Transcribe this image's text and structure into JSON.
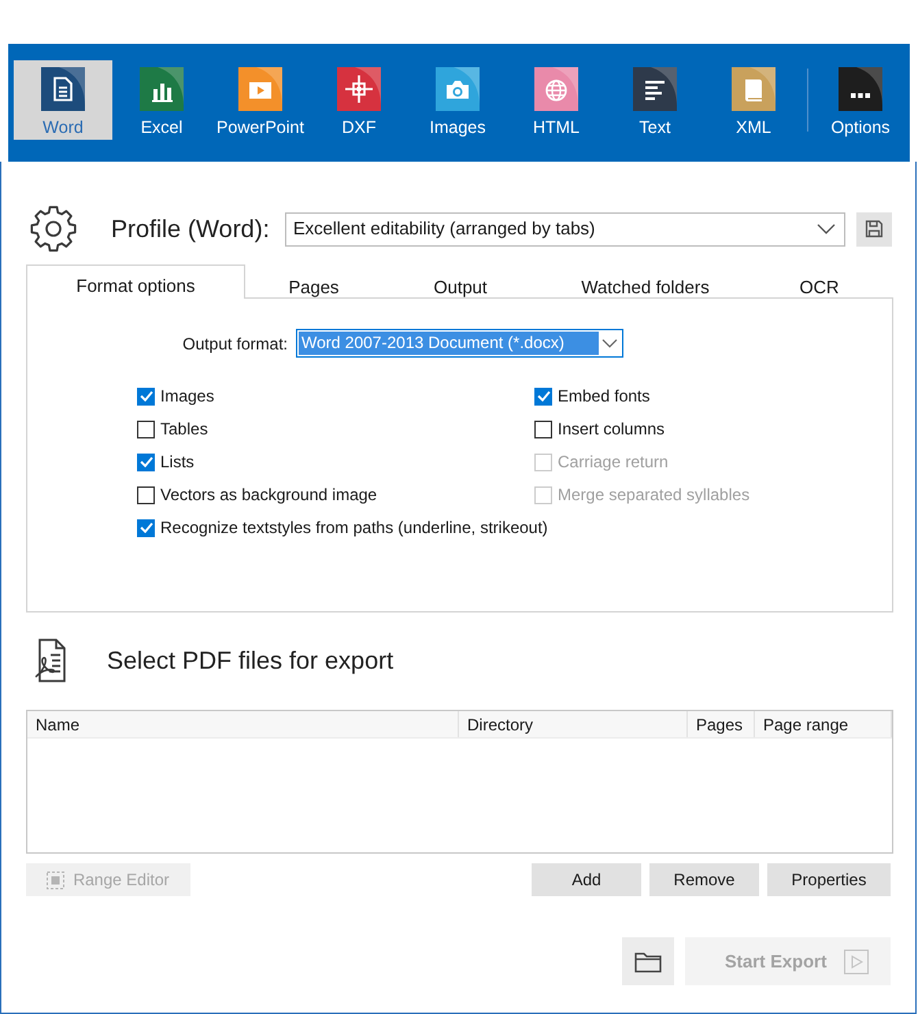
{
  "toolbar": {
    "formats": [
      {
        "kind": "word",
        "label": "Word",
        "selected": true
      },
      {
        "kind": "excel",
        "label": "Excel",
        "selected": false
      },
      {
        "kind": "powerpoint",
        "label": "PowerPoint",
        "selected": false
      },
      {
        "kind": "dxf",
        "label": "DXF",
        "selected": false
      },
      {
        "kind": "images",
        "label": "Images",
        "selected": false
      },
      {
        "kind": "html",
        "label": "HTML",
        "selected": false
      },
      {
        "kind": "text",
        "label": "Text",
        "selected": false
      },
      {
        "kind": "xml",
        "label": "XML",
        "selected": false
      }
    ],
    "options": {
      "label": "Options"
    }
  },
  "profile": {
    "label": "Profile (Word):",
    "value": "Excellent editability (arranged by tabs)"
  },
  "tabs": [
    {
      "label": "Format options",
      "selected": true
    },
    {
      "label": "Pages",
      "selected": false
    },
    {
      "label": "Output",
      "selected": false
    },
    {
      "label": "Watched folders",
      "selected": false
    },
    {
      "label": "OCR",
      "selected": false
    }
  ],
  "format_options": {
    "output_format": {
      "label": "Output format:",
      "value": "Word 2007-2013 Document (*.docx)"
    },
    "left_options": [
      {
        "label": "Images",
        "checked": true,
        "disabled": false
      },
      {
        "label": "Tables",
        "checked": false,
        "disabled": false
      },
      {
        "label": "Lists",
        "checked": true,
        "disabled": false
      },
      {
        "label": "Vectors as background image",
        "checked": false,
        "disabled": false
      },
      {
        "label": "Recognize textstyles from paths (underline, strikeout)",
        "checked": true,
        "disabled": false
      }
    ],
    "right_options": [
      {
        "label": "Embed fonts",
        "checked": true,
        "disabled": false
      },
      {
        "label": "Insert columns",
        "checked": false,
        "disabled": false
      },
      {
        "label": "Carriage return",
        "checked": false,
        "disabled": true
      },
      {
        "label": "Merge separated syllables",
        "checked": false,
        "disabled": true
      }
    ]
  },
  "pdf_files": {
    "title": "Select PDF files for export",
    "columns": [
      "Name",
      "Directory",
      "Pages",
      "Page range"
    ],
    "range_editor": {
      "label": "Range Editor",
      "disabled": true
    },
    "buttons": [
      "Add",
      "Remove",
      "Properties"
    ]
  },
  "footer": {
    "start_export": {
      "label": "Start Export",
      "disabled": true
    }
  }
}
